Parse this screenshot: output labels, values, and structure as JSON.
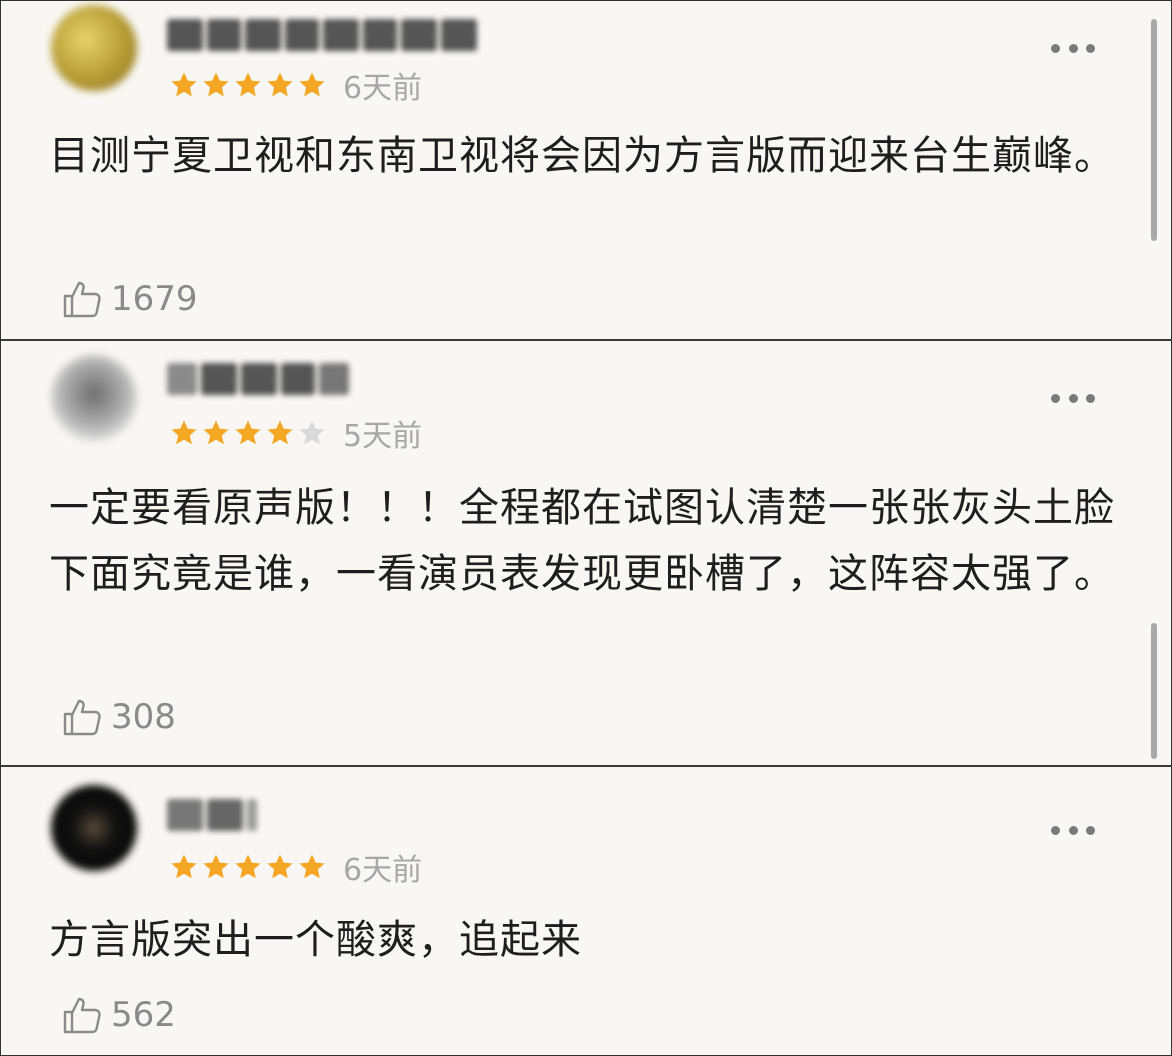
{
  "accent": {
    "star": "#f5a623",
    "star_empty": "#d9d9d9"
  },
  "comments": [
    {
      "time": "6天前",
      "rating": 5,
      "text": "目测宁夏卫视和东南卫视将会因为方言版而迎来台生巅峰。",
      "likes": "1679",
      "avatar_icon": "user-avatar-blurred",
      "more_icon": "more-options-icon"
    },
    {
      "time": "5天前",
      "rating": 4,
      "text": "一定要看原声版！！！全程都在试图认清楚一张张灰头土脸下面究竟是谁，一看演员表发现更卧槽了，这阵容太强了。",
      "likes": "308",
      "avatar_icon": "user-avatar-blurred",
      "more_icon": "more-options-icon"
    },
    {
      "time": "6天前",
      "rating": 5,
      "text": "方言版突出一个酸爽，追起来",
      "likes": "562",
      "avatar_icon": "user-avatar-blurred",
      "more_icon": "more-options-icon"
    }
  ]
}
